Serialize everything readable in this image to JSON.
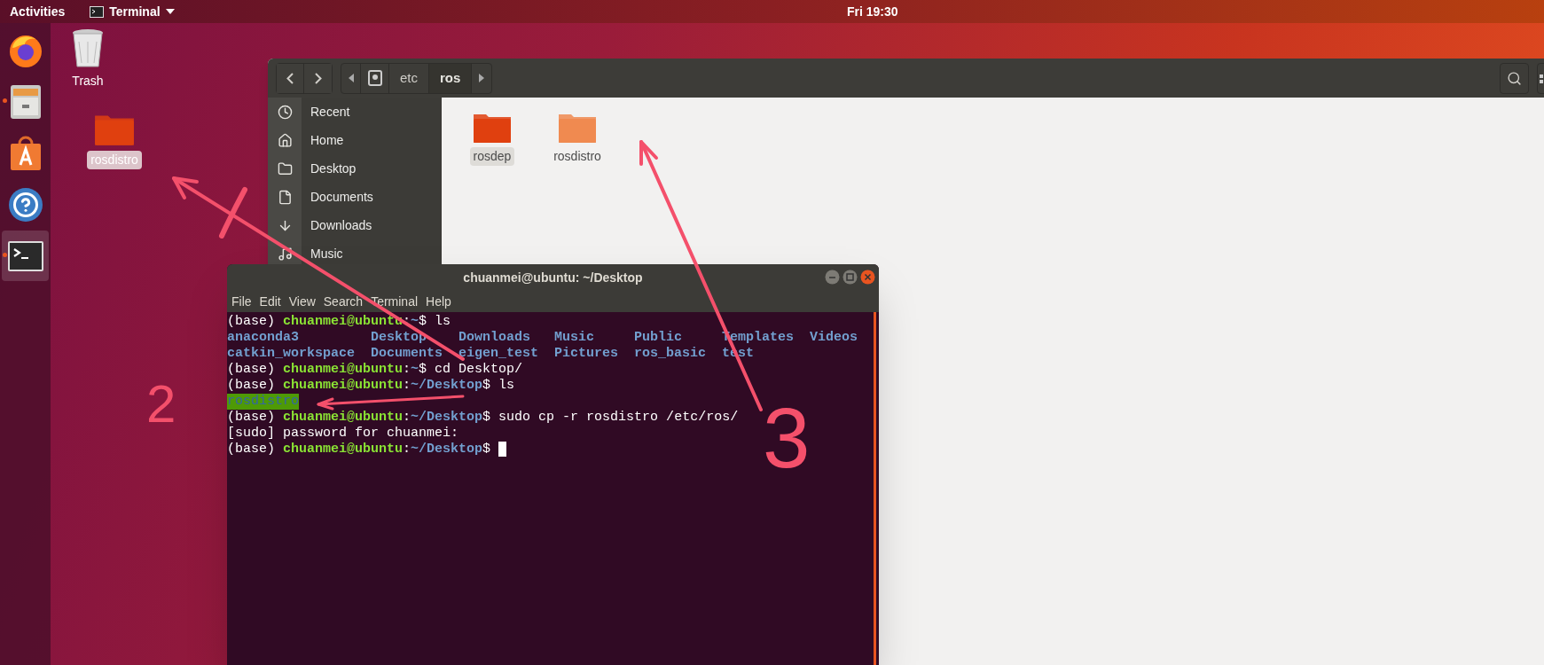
{
  "top_bar": {
    "activities": "Activities",
    "app_menu": "Terminal",
    "clock": "Fri 19:30"
  },
  "dock": {
    "apps": [
      {
        "kind": "firefox",
        "selected": false
      },
      {
        "kind": "files",
        "running": true,
        "selected": false
      },
      {
        "kind": "software",
        "selected": false
      },
      {
        "kind": "help",
        "selected": false
      },
      {
        "kind": "terminal",
        "running": true,
        "selected": true
      }
    ]
  },
  "desktop": {
    "icons": [
      {
        "kind": "trash",
        "label": "Trash",
        "selected": false
      },
      {
        "kind": "folder",
        "label": "rosdistro",
        "selected": true
      }
    ]
  },
  "file_manager": {
    "path": [
      {
        "label": "etc",
        "selected": false
      },
      {
        "label": "ros",
        "selected": true
      }
    ],
    "sidebar": {
      "items": [
        {
          "kind": "recent",
          "label": "Recent",
          "selected": false
        },
        {
          "kind": "home",
          "label": "Home",
          "selected": false
        },
        {
          "kind": "desktop",
          "label": "Desktop",
          "selected": false
        },
        {
          "kind": "documents",
          "label": "Documents",
          "selected": false
        },
        {
          "kind": "downloads",
          "label": "Downloads",
          "selected": false
        },
        {
          "kind": "music",
          "label": "Music",
          "selected": false
        }
      ]
    },
    "files": [
      {
        "label": "rosdep",
        "selected": true,
        "color": "#e0400f"
      },
      {
        "label": "rosdistro",
        "selected": false,
        "color": "#f08a50"
      }
    ]
  },
  "terminal": {
    "title": "chuanmei@ubuntu: ~/Desktop",
    "menu": [
      "File",
      "Edit",
      "View",
      "Search",
      "Terminal",
      "Help"
    ],
    "lines": [
      {
        "kind": "prompt",
        "env": "(base) ",
        "user": "chuanmei@ubuntu",
        "sep": ":",
        "path": "~",
        "symbol": "$ ",
        "command": "ls"
      },
      {
        "kind": "listing",
        "items": [
          "anaconda3",
          "Desktop",
          "Downloads",
          "Music",
          "Public",
          "Templates",
          "Videos"
        ]
      },
      {
        "kind": "listing",
        "items": [
          "catkin_workspace",
          "Documents",
          "eigen_test",
          "Pictures",
          "ros_basic",
          "test"
        ]
      },
      {
        "kind": "prompt",
        "env": "(base) ",
        "user": "chuanmei@ubuntu",
        "sep": ":",
        "path": "~",
        "symbol": "$ ",
        "command": "cd Desktop/"
      },
      {
        "kind": "prompt",
        "env": "(base) ",
        "user": "chuanmei@ubuntu",
        "sep": ":",
        "path": "~/Desktop",
        "symbol": "$ ",
        "command": "ls"
      },
      {
        "kind": "highlight",
        "text": "rosdistro"
      },
      {
        "kind": "prompt",
        "env": "(base) ",
        "user": "chuanmei@ubuntu",
        "sep": ":",
        "path": "~/Desktop",
        "symbol": "$ ",
        "command": "sudo cp -r rosdistro /etc/ros/"
      },
      {
        "kind": "output",
        "text": "[sudo] password for chuanmei:"
      },
      {
        "kind": "prompt",
        "env": "(base) ",
        "user": "chuanmei@ubuntu",
        "sep": ":",
        "path": "~/Desktop",
        "symbol": "$ ",
        "cursor": true
      }
    ]
  },
  "annotations": {
    "labels": [
      "2",
      "3"
    ]
  }
}
